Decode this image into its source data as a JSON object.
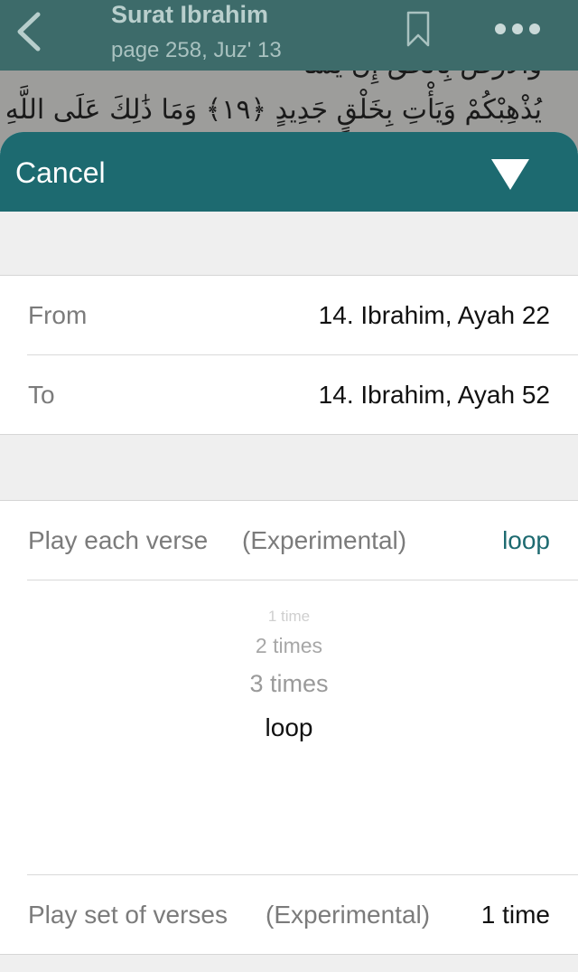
{
  "header": {
    "title": "Surat Ibrahim",
    "subtitle": "page 258, Juz' 13"
  },
  "quran": {
    "line_top": "وَالْأَرْضَ بِالْحَقِّ إِن يَشَأْ",
    "line_main": "يُذْهِبْكُمْ وَيَأْتِ بِخَلْقٍ جَدِيدٍ ﴿١٩﴾ وَمَا ذَٰلِكَ عَلَى اللَّهِ بِعَزِيزٍ"
  },
  "sheet": {
    "cancel_label": "Cancel",
    "range": {
      "from_label": "From",
      "from_value": "14. Ibrahim, Ayah 22",
      "to_label": "To",
      "to_value": "14. Ibrahim, Ayah 52"
    },
    "verse_repeat": {
      "label": "Play each verse",
      "note": "(Experimental)",
      "value": "loop"
    },
    "picker_options": [
      "1 time",
      "2 times",
      "3 times",
      "loop"
    ],
    "set_repeat": {
      "label": "Play set of verses",
      "note": "(Experimental)",
      "value": "1 time"
    }
  },
  "colors": {
    "accent": "#1d6a70",
    "header_bg": "#3d6b6a"
  },
  "icons": [
    "back-chevron-icon",
    "bookmark-icon",
    "more-icon",
    "collapse-triangle-icon"
  ]
}
